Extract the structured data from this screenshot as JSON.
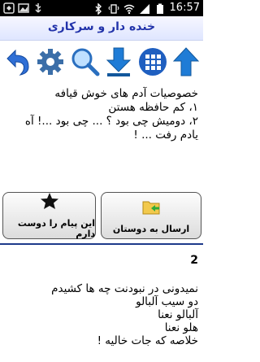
{
  "status_bar": {
    "time": "16:57",
    "icons_left": [
      "notification-icon",
      "image-icon",
      "usb-icon"
    ],
    "icons_right": [
      "bluetooth-icon",
      "vibrate-icon",
      "wifi-icon",
      "signal-icon",
      "battery-icon"
    ]
  },
  "app": {
    "title": "خنده دار و سرکاری"
  },
  "toolbar": {
    "buttons": [
      {
        "name": "back-icon",
        "color": "#2f6fd6"
      },
      {
        "name": "settings-icon",
        "color": "#3b6ea8"
      },
      {
        "name": "search-icon",
        "color": "#2a6fbf"
      },
      {
        "name": "download-icon",
        "color": "#1f7cd6"
      },
      {
        "name": "grid-icon",
        "color": "#1f5fc0"
      },
      {
        "name": "up-arrow-icon",
        "color": "#1f7cd6"
      }
    ]
  },
  "top_text": {
    "lines": [
      "خصوصیات آدم های خوش قیافه",
      "۱، کم حافظه هستن",
      "۲، دومیش چی بود ؟ ... چی بود ...! آه",
      "یادم رفت ... !"
    ]
  },
  "actions": {
    "send_label": "ارسال به دوستان",
    "like_label": "این پیام را دوست دارم"
  },
  "second_item": {
    "number": "2",
    "lines": [
      "نمیدونی در نبودنت چه ها کشیدم",
      "دو سیب آلبالو",
      "آلبالو نعنا",
      "هلو نعنا",
      "خلاصه که جات خالیه !"
    ]
  }
}
